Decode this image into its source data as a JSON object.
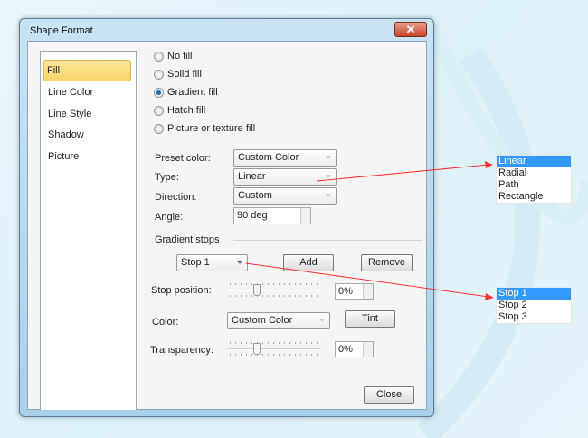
{
  "dialog": {
    "title": "Shape Format",
    "close_icon": "close-icon"
  },
  "sidebar": {
    "items": [
      {
        "label": "Fill",
        "selected": true
      },
      {
        "label": "Line Color"
      },
      {
        "label": "Line Style"
      },
      {
        "label": "Shadow"
      },
      {
        "label": "Picture"
      }
    ]
  },
  "fill_options": [
    {
      "label": "No fill",
      "checked": false
    },
    {
      "label": "Solid fill",
      "checked": false
    },
    {
      "label": "Gradient fill",
      "checked": true
    },
    {
      "label": "Hatch fill",
      "checked": false
    },
    {
      "label": "Picture or texture fill",
      "checked": false
    }
  ],
  "form": {
    "preset_label": "Preset color:",
    "preset_value": "Custom Color",
    "type_label": "Type:",
    "type_value": "Linear",
    "direction_label": "Direction:",
    "direction_value": "Custom",
    "angle_label": "Angle:",
    "angle_value": "90 deg"
  },
  "stops": {
    "heading": "Gradient  stops",
    "stop_value": "Stop 1",
    "add": "Add",
    "remove": "Remove",
    "position_label": "Stop position:",
    "position_value": "0%",
    "color_label": "Color:",
    "color_value": "Custom Color",
    "tint": "Tint",
    "transparency_label": "Transparency:",
    "transparency_value": "0%"
  },
  "close_button": "Close",
  "type_list": [
    "Linear",
    "Radial",
    "Path",
    "Rectangle"
  ],
  "stop_list": [
    "Stop 1",
    "Stop 2",
    "Stop 3"
  ],
  "colors": {
    "accent": "#3399ff",
    "arrow": "#ff3333",
    "selection": "#fbd36a"
  }
}
